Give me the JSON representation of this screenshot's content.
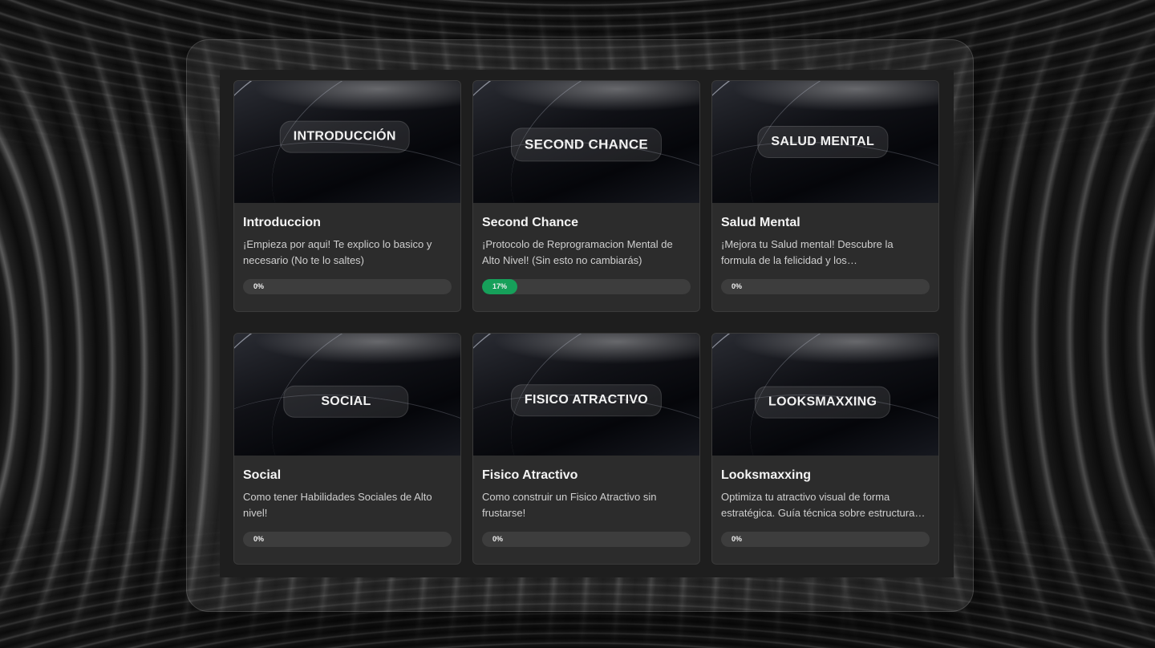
{
  "theme": {
    "progress_color": "#16a05a"
  },
  "courses": [
    {
      "thumb_label": "INTRODUCCIÓN",
      "title": "Introduccion",
      "description": "¡Empieza por aqui! Te explico lo basico y necesario (No te lo saltes)",
      "progress": 0,
      "progress_label": "0%"
    },
    {
      "thumb_label": "SECOND CHANCE",
      "title": "Second Chance",
      "description": "¡Protocolo de Reprogramacion Mental de Alto Nivel! (Sin esto no cambiarás)",
      "progress": 17,
      "progress_label": "17%"
    },
    {
      "thumb_label": "SALUD MENTAL",
      "title": "Salud Mental",
      "description": "¡Mejora tu Salud mental! Descubre la formula de la felicidad y los Neurotransmisores…",
      "progress": 0,
      "progress_label": "0%"
    },
    {
      "thumb_label": "SOCIAL",
      "title": "Social",
      "description": "Como tener Habilidades Sociales de Alto nivel!",
      "progress": 0,
      "progress_label": "0%"
    },
    {
      "thumb_label": "FISICO ATRACTIVO",
      "title": "Fisico Atractivo",
      "description": "Como construir un Fisico Atractivo sin frustarse!",
      "progress": 0,
      "progress_label": "0%"
    },
    {
      "thumb_label": "LOOKSMAXXING",
      "title": "Looksmaxxing",
      "description": "Optimiza tu atractivo visual de forma estratégica. Guía técnica sobre estructura…",
      "progress": 0,
      "progress_label": "0%"
    }
  ]
}
